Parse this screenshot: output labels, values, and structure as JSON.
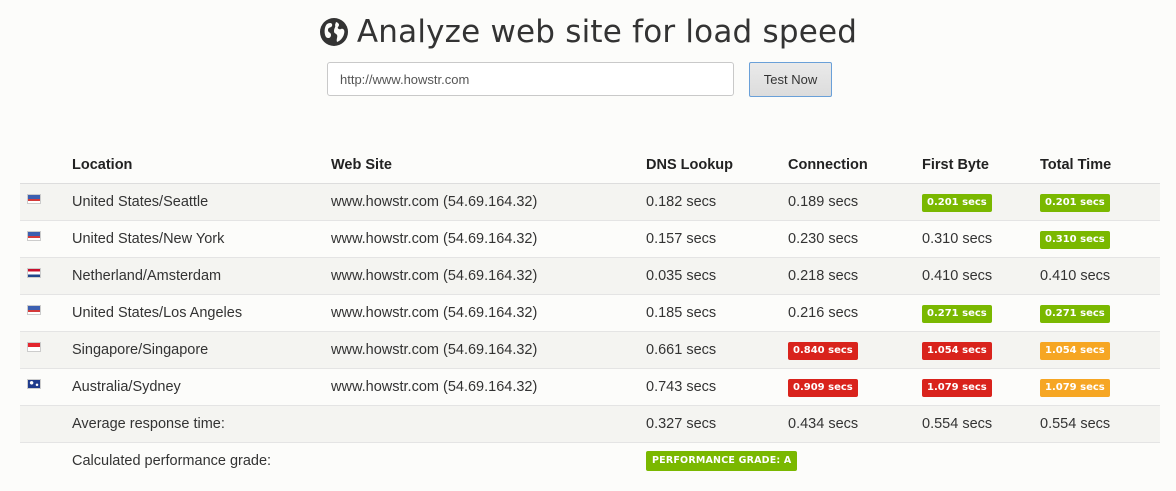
{
  "header": {
    "title": "Analyze web site for load speed",
    "icon": "globe-icon"
  },
  "form": {
    "url_value": "http://www.howstr.com",
    "button_label": "Test Now"
  },
  "table": {
    "columns": [
      "Location",
      "Web Site",
      "DNS Lookup",
      "Connection",
      "First Byte",
      "Total Time"
    ],
    "rows": [
      {
        "flag": "us-flag-icon",
        "location": "United States/Seattle",
        "site": "www.howstr.com (54.69.164.32)",
        "dns": "0.182 secs",
        "connection": "0.189 secs",
        "first_byte": "0.201 secs",
        "total": "0.201 secs"
      },
      {
        "flag": "us-flag-icon",
        "location": "United States/New York",
        "site": "www.howstr.com (54.69.164.32)",
        "dns": "0.157 secs",
        "connection": "0.230 secs",
        "first_byte": "0.310 secs",
        "total": "0.310 secs"
      },
      {
        "flag": "nl-flag-icon",
        "location": "Netherland/Amsterdam",
        "site": "www.howstr.com (54.69.164.32)",
        "dns": "0.035 secs",
        "connection": "0.218 secs",
        "first_byte": "0.410 secs",
        "total": "0.410 secs"
      },
      {
        "flag": "us-flag-icon",
        "location": "United States/Los Angeles",
        "site": "www.howstr.com (54.69.164.32)",
        "dns": "0.185 secs",
        "connection": "0.216 secs",
        "first_byte": "0.271 secs",
        "total": "0.271 secs"
      },
      {
        "flag": "sg-flag-icon",
        "location": "Singapore/Singapore",
        "site": "www.howstr.com (54.69.164.32)",
        "dns": "0.661 secs",
        "connection": "0.840 secs",
        "first_byte": "1.054 secs",
        "total": "1.054 secs"
      },
      {
        "flag": "au-flag-icon",
        "location": "Australia/Sydney",
        "site": "www.howstr.com (54.69.164.32)",
        "dns": "0.743 secs",
        "connection": "0.909 secs",
        "first_byte": "1.079 secs",
        "total": "1.079 secs"
      }
    ],
    "average": {
      "label": "Average response time:",
      "dns": "0.327 secs",
      "connection": "0.434 secs",
      "first_byte": "0.554 secs",
      "total": "0.554 secs"
    },
    "grade": {
      "label": "Calculated performance grade:",
      "value": "PERFORMANCE GRADE: A"
    }
  },
  "colors": {
    "green": "#7ab800",
    "red": "#d9231c",
    "orange": "#f6a623"
  }
}
